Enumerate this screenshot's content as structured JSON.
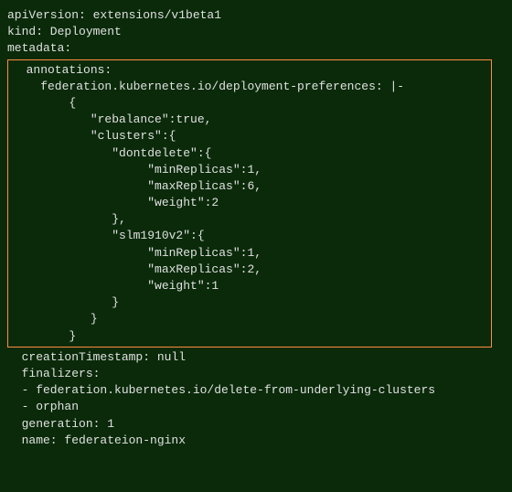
{
  "yaml": {
    "line1": "apiVersion: extensions/v1beta1",
    "line2": "kind: Deployment",
    "line3": "metadata:",
    "annotations": {
      "header": "  annotations:",
      "pref_key": "    federation.kubernetes.io/deployment-preferences: |-",
      "brace_open": "        {",
      "rebalance": "           \"rebalance\":true,",
      "clusters_open": "           \"clusters\":{",
      "dontdelete_open": "              \"dontdelete\":{",
      "dd_min": "                   \"minReplicas\":1,",
      "dd_max": "                   \"maxReplicas\":6,",
      "dd_weight": "                   \"weight\":2",
      "dd_close": "              },",
      "slm_open": "              \"slm1910v2\":{",
      "slm_min": "                   \"minReplicas\":1,",
      "slm_max": "                   \"maxReplicas\":2,",
      "slm_weight": "                   \"weight\":1",
      "slm_close": "              }",
      "clusters_close": "           }",
      "brace_close": "        }"
    },
    "creationTimestamp": "  creationTimestamp: null",
    "finalizers": "  finalizers:",
    "finalizer1": "  - federation.kubernetes.io/delete-from-underlying-clusters",
    "finalizer2": "  - orphan",
    "generation": "  generation: 1",
    "name": "  name: federateion-nginx"
  }
}
